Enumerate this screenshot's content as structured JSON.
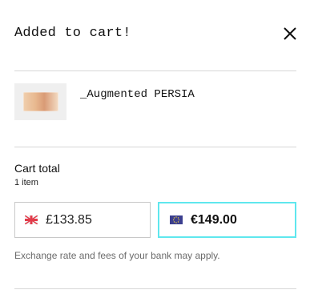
{
  "header": {
    "title": "Added to cart!",
    "close_icon": "close-icon"
  },
  "product": {
    "name": "_Augmented PERSIA",
    "thumbnail_icon": "product-thumbnail"
  },
  "summary": {
    "label": "Cart total",
    "count": "1 item"
  },
  "currencies": [
    {
      "flag": "uk-flag-icon",
      "amount": "£133.85",
      "selected": false
    },
    {
      "flag": "eu-flag-icon",
      "amount": "€149.00",
      "selected": true
    }
  ],
  "note": "Exchange rate and fees of your bank may apply.",
  "colors": {
    "selected_border": "#5fe7ee",
    "divider": "#d6d6d6"
  }
}
